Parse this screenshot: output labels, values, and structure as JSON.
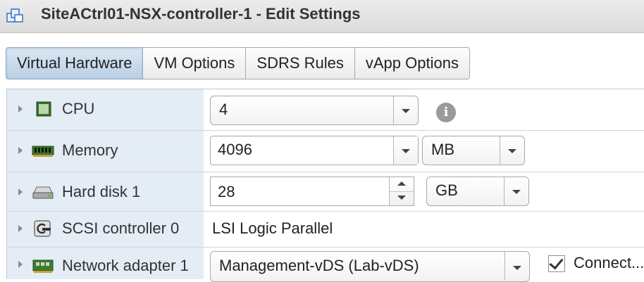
{
  "window": {
    "title": "SiteACtrl01-NSX-controller-1 - Edit Settings",
    "icon": "vm-settings-icon"
  },
  "tabs": [
    {
      "label": "Virtual Hardware",
      "active": true
    },
    {
      "label": "VM Options",
      "active": false
    },
    {
      "label": "SDRS Rules",
      "active": false
    },
    {
      "label": "vApp Options",
      "active": false
    }
  ],
  "hardware": {
    "cpu": {
      "label": "CPU",
      "icon": "cpu-icon",
      "value": "4"
    },
    "memory": {
      "label": "Memory",
      "icon": "memory-icon",
      "value": "4096",
      "unit": "MB"
    },
    "hard_disk": {
      "label": "Hard disk 1",
      "icon": "hard-disk-icon",
      "value": "28",
      "unit": "GB"
    },
    "scsi": {
      "label": "SCSI controller 0",
      "icon": "scsi-controller-icon",
      "value": "LSI Logic Parallel"
    },
    "network": {
      "label": "Network adapter 1",
      "icon": "network-adapter-icon",
      "value": "Management-vDS (Lab-vDS)",
      "connect_label": "Connect...",
      "connected": true
    }
  },
  "colors": {
    "active_tab": "#b9cfe6",
    "label_column": "#e4ecf5",
    "titlebar": "#e4e4e4"
  }
}
